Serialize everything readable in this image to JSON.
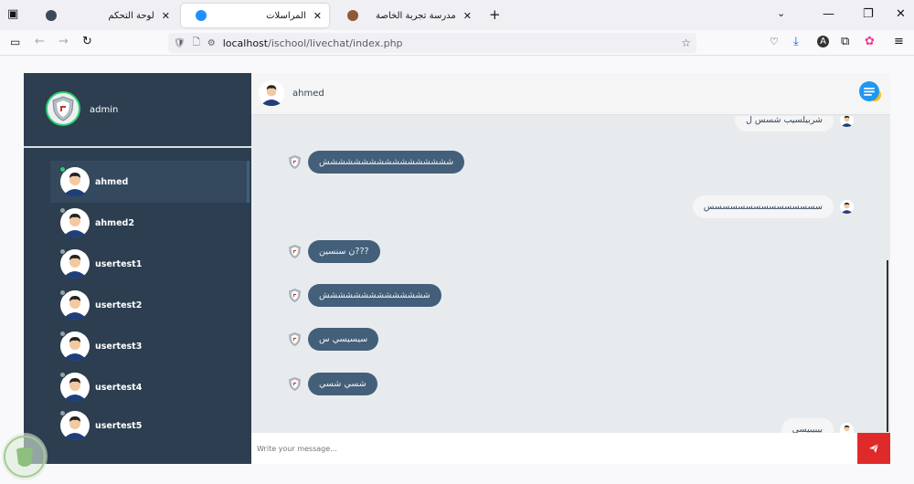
{
  "browser": {
    "tabs": [
      {
        "title": "لوحة التحكم",
        "active": false
      },
      {
        "title": "المراسلات",
        "active": true
      },
      {
        "title": "مدرسة تجربة الخاصة",
        "active": false
      }
    ],
    "url_host": "localhost",
    "url_path": "/ischool/livechat/index.php"
  },
  "sidebar": {
    "admin_name": "admin",
    "contacts": [
      {
        "name": "ahmed",
        "status": "online",
        "active": true
      },
      {
        "name": "ahmed2",
        "status": "offline",
        "active": false
      },
      {
        "name": "usertest1",
        "status": "offline",
        "active": false
      },
      {
        "name": "usertest2",
        "status": "offline",
        "active": false
      },
      {
        "name": "usertest3",
        "status": "offline",
        "active": false
      },
      {
        "name": "usertest4",
        "status": "offline",
        "active": false
      },
      {
        "name": "usertest5",
        "status": "offline",
        "active": false
      }
    ]
  },
  "chat": {
    "contact_name": "ahmed",
    "messages": [
      {
        "side": "recv",
        "text": "شربيلسيب شسس ل"
      },
      {
        "side": "sent",
        "text": "ششششششششششششششششش"
      },
      {
        "side": "recv",
        "text": "سسسسسسسسسسسسسسس"
      },
      {
        "side": "sent",
        "text": "???ن سنسين"
      },
      {
        "side": "sent",
        "text": "شششششششششششششش"
      },
      {
        "side": "sent",
        "text": "سيسيسي س"
      },
      {
        "side": "sent",
        "text": "شسي شسي"
      },
      {
        "side": "recv",
        "text": "بيبيبيسي"
      }
    ],
    "input_placeholder": "Write your message..."
  },
  "colors": {
    "sidebar_bg": "#2c3e50",
    "sent_bubble": "#435f7a",
    "send_button": "#e02a2a",
    "online": "#2ecc71"
  }
}
